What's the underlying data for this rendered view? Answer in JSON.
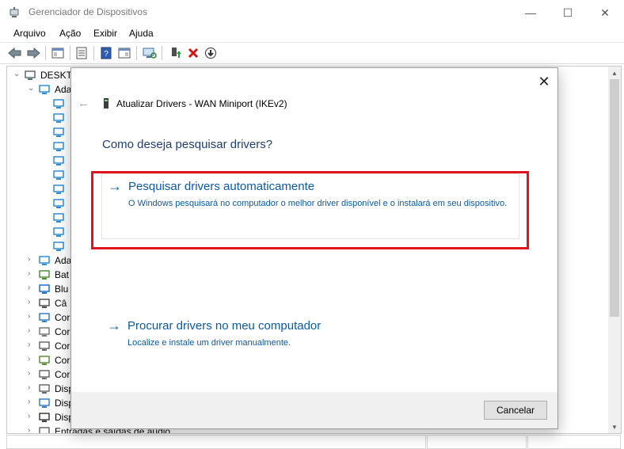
{
  "window": {
    "title": "Gerenciador de Dispositivos",
    "minimize_glyph": "—",
    "maximize_glyph": "☐",
    "close_glyph": "✕"
  },
  "menu": {
    "items": [
      {
        "label": "Arquivo"
      },
      {
        "label": "Ação"
      },
      {
        "label": "Exibir"
      },
      {
        "label": "Ajuda"
      }
    ]
  },
  "toolbar": {
    "icons": [
      "back-icon",
      "forward-icon",
      "properties-icon",
      "update-driver-icon",
      "help-icon",
      "resource-view-icon",
      "scan-hardware-icon",
      "enable-device-icon",
      "uninstall-device-icon",
      "download-driver-icon"
    ]
  },
  "tree": {
    "root": "DESKTO",
    "rows": [
      {
        "label": "DESKTO",
        "expander": "⌄",
        "indent": 0,
        "icon": "computer-icon"
      },
      {
        "label": "Ada",
        "expander": "⌄",
        "indent": 1,
        "icon": "network-adapter-icon"
      },
      {
        "label": "",
        "expander": "",
        "indent": 2,
        "icon": "network-adapter-icon"
      },
      {
        "label": "",
        "expander": "",
        "indent": 2,
        "icon": "network-adapter-icon"
      },
      {
        "label": "",
        "expander": "",
        "indent": 2,
        "icon": "network-adapter-icon"
      },
      {
        "label": "",
        "expander": "",
        "indent": 2,
        "icon": "network-adapter-icon"
      },
      {
        "label": "",
        "expander": "",
        "indent": 2,
        "icon": "network-adapter-icon"
      },
      {
        "label": "",
        "expander": "",
        "indent": 2,
        "icon": "network-adapter-icon"
      },
      {
        "label": "",
        "expander": "",
        "indent": 2,
        "icon": "network-adapter-icon"
      },
      {
        "label": "",
        "expander": "",
        "indent": 2,
        "icon": "network-adapter-icon"
      },
      {
        "label": "",
        "expander": "",
        "indent": 2,
        "icon": "network-adapter-icon"
      },
      {
        "label": "",
        "expander": "",
        "indent": 2,
        "icon": "network-adapter-icon"
      },
      {
        "label": "",
        "expander": "",
        "indent": 2,
        "icon": "network-adapter-icon"
      },
      {
        "label": "Ada",
        "expander": "›",
        "indent": 1,
        "icon": "display-adapter-icon"
      },
      {
        "label": "Bat",
        "expander": "›",
        "indent": 1,
        "icon": "battery-icon"
      },
      {
        "label": "Blu",
        "expander": "›",
        "indent": 1,
        "icon": "bluetooth-icon"
      },
      {
        "label": "Câ",
        "expander": "›",
        "indent": 1,
        "icon": "camera-icon"
      },
      {
        "label": "Cor",
        "expander": "›",
        "indent": 1,
        "icon": "monitor-icon"
      },
      {
        "label": "Cor",
        "expander": "›",
        "indent": 1,
        "icon": "controller-icon"
      },
      {
        "label": "Cor",
        "expander": "›",
        "indent": 1,
        "icon": "audio-controller-icon"
      },
      {
        "label": "Cor",
        "expander": "›",
        "indent": 1,
        "icon": "storage-controller-icon"
      },
      {
        "label": "Cor",
        "expander": "›",
        "indent": 1,
        "icon": "usb-controller-icon"
      },
      {
        "label": "Disp",
        "expander": "›",
        "indent": 1,
        "icon": "hid-device-icon"
      },
      {
        "label": "Disp",
        "expander": "›",
        "indent": 1,
        "icon": "software-device-icon"
      },
      {
        "label": "Disp",
        "expander": "›",
        "indent": 1,
        "icon": "system-device-icon"
      },
      {
        "label": "Entradas e saídas de áudio",
        "expander": "›",
        "indent": 1,
        "icon": "audio-io-icon"
      }
    ]
  },
  "dialog": {
    "close_glyph": "✕",
    "back_glyph": "←",
    "title": "Atualizar Drivers - WAN Miniport (IKEv2)",
    "question": "Como deseja pesquisar drivers?",
    "option_auto": {
      "arrow": "→",
      "title": "Pesquisar drivers automaticamente",
      "description": "O Windows pesquisará no computador o melhor driver disponível e o instalará em seu dispositivo."
    },
    "option_manual": {
      "arrow": "→",
      "title": "Procurar drivers no meu computador",
      "description": "Localize e instale um driver manualmente."
    },
    "cancel_label": "Cancelar"
  },
  "colors": {
    "link_blue": "#0a5aa8",
    "heading_blue": "#1c3d78",
    "highlight_red": "#e0141c"
  }
}
